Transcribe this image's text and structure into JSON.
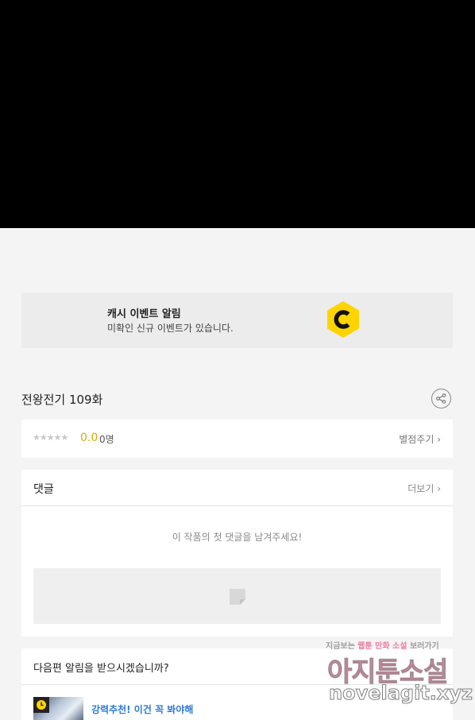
{
  "event_banner": {
    "title": "캐시 이벤트 알림",
    "description": "미확인 신규 이벤트가 있습니다.",
    "icon": "cash-c-icon",
    "icon_color": "#ffd400"
  },
  "episode": {
    "title": "전왕전기 109화",
    "share_icon": "share-icon"
  },
  "rating": {
    "stars": "★★★★★",
    "score": "0.0",
    "count": "0명",
    "rate_link": "별점주기 ›",
    "score_color": "#e0a800"
  },
  "comments": {
    "title": "댓글",
    "more_link": "더보기 ›",
    "empty_message": "이 작품의 첫 댓글을 남겨주세요!",
    "write_icon": "comment-write-icon"
  },
  "next_episode": {
    "title": "다음편 알림을 받으시겠습니까?",
    "recommendation": "강력추천! 이건 꼭 봐야해",
    "badge_icon": "clock-icon",
    "link_color": "#2d7ad6"
  },
  "watermark": {
    "top_left": "지금보는 ",
    "top_pink": "웹툰 만화 소설",
    "top_right": " 보러가기",
    "middle": "아지툰소설",
    "bottom": "novelagit.xyz"
  }
}
